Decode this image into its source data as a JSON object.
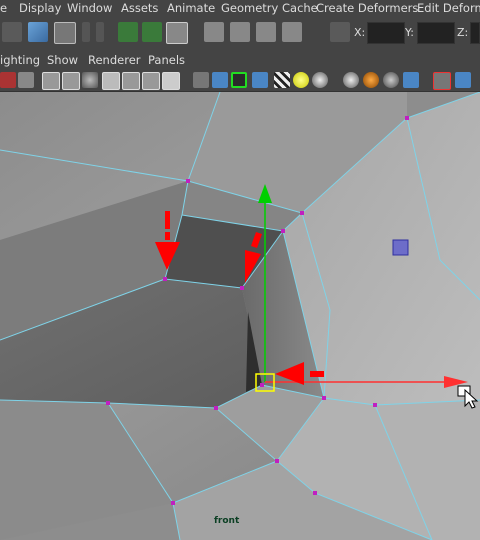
{
  "menubar": {
    "items": [
      "e",
      "Display",
      "Window",
      "Assets",
      "Animate",
      "Geometry Cache",
      "Create Deformers",
      "Edit Deformer"
    ]
  },
  "toolbar": {
    "x_label": "X:",
    "y_label": "Y:",
    "z_label": "Z:"
  },
  "panel_menu": {
    "items": [
      "ighting",
      "Show",
      "Renderer",
      "Panels"
    ]
  },
  "viewport": {
    "camera_label": "front",
    "wire_color": "#7fd3e8",
    "vertex_color": "#c020c0",
    "arrow_color": "#ff0000",
    "y_axis_color": "#00d000",
    "x_axis_color": "#ff3030",
    "manipulator_color": "#ffff00"
  }
}
